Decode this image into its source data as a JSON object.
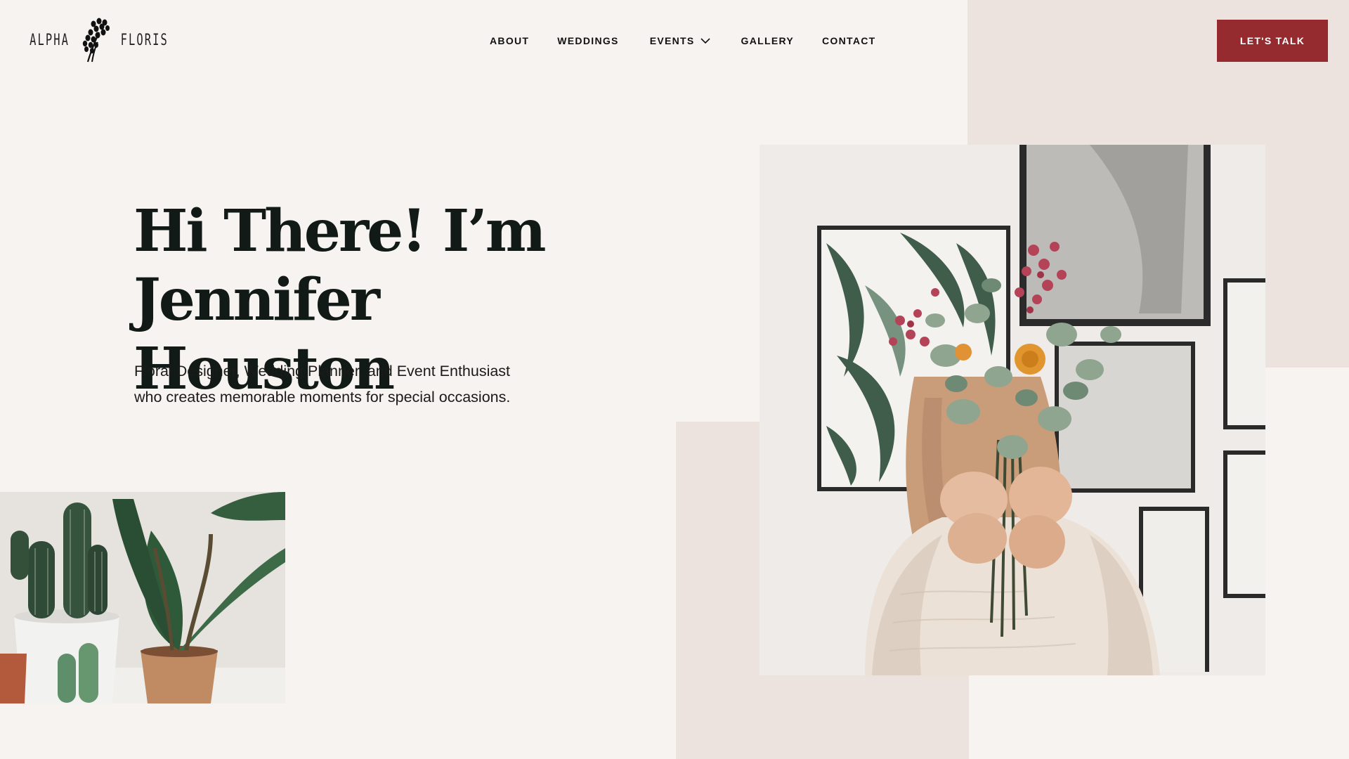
{
  "brand": {
    "left_word": "ALPHA",
    "right_word": "FLORIS"
  },
  "nav": {
    "items": [
      {
        "label": "ABOUT"
      },
      {
        "label": "WEDDINGS"
      },
      {
        "label": "EVENTS",
        "has_dropdown": true
      },
      {
        "label": "GALLERY"
      },
      {
        "label": "CONTACT"
      }
    ],
    "cta_label": "LET'S TALK"
  },
  "hero": {
    "title_line1": "Hi There! I’m",
    "title_line2": "Jennifer Houston",
    "subtitle_line1": "Floral Designer, Wedding Planner, and Event Enthusiast",
    "subtitle_line2": "who creates memorable moments for special occasions."
  },
  "images": {
    "main": "woman-holding-flower-bouquet-photo",
    "secondary": "potted-cactus-and-plants-photo"
  },
  "colors": {
    "background": "#f7f3f0",
    "accent_block": "#ece3de",
    "cta": "#952a2f",
    "title": "#111a16"
  }
}
